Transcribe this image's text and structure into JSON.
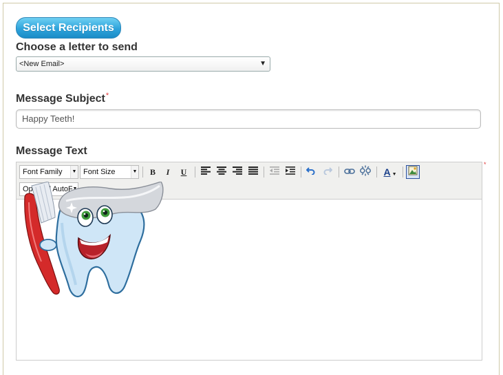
{
  "recipients_button": {
    "label": "Select Recipients"
  },
  "letter": {
    "label": "Choose a letter to send",
    "selected": "<New Email>"
  },
  "subject": {
    "label": "Message Subject",
    "required_mark": "*",
    "value": "Happy Teeth!"
  },
  "message": {
    "label": "Message Text",
    "required_mark": "*"
  },
  "toolbar": {
    "font_family": "Font Family",
    "font_size": "Font Size",
    "bold": "B",
    "italic": "I",
    "underline": "U",
    "autofill": "Optional AutoF",
    "text_color": "A"
  },
  "colors": {
    "accent": "#2ea3db",
    "required": "#e03a3a",
    "toolbar_bg": "#f0f0ee"
  },
  "icons": [
    "align-left-icon",
    "align-center-icon",
    "align-right-icon",
    "align-justify-icon",
    "outdent-icon",
    "indent-icon",
    "undo-icon",
    "redo-icon",
    "link-icon",
    "unlink-icon",
    "text-color-icon",
    "insert-image-icon",
    "tooth-mascot-image"
  ]
}
